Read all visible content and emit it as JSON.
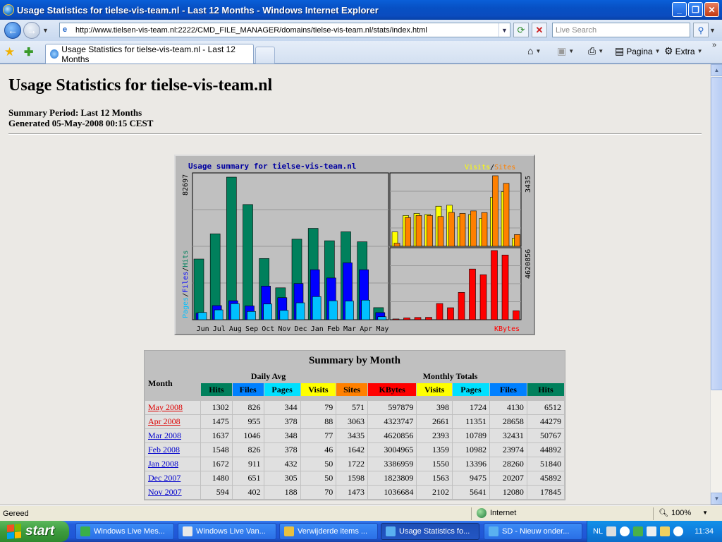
{
  "window": {
    "title": "Usage Statistics for tielse-vis-team.nl - Last 12 Months - Windows Internet Explorer",
    "url": "http://www.tielsen-vis-team.nl:2222/CMD_FILE_MANAGER/domains/tielse-vis-team.nl/stats/index.html",
    "search_placeholder": "Live Search",
    "tab_label": "Usage Statistics for tielse-vis-team.nl - Last 12 Months",
    "cmd_pagina": "Pagina",
    "cmd_extra": "Extra"
  },
  "page": {
    "title": "Usage Statistics for tielse-vis-team.nl",
    "summary_period": "Summary Period: Last 12 Months",
    "generated": "Generated 05-May-2008 00:15 CEST"
  },
  "chart_data": {
    "type": "bar",
    "title": "Usage summary for tielse-vis-team.nl",
    "categories": [
      "Jun",
      "Jul",
      "Aug",
      "Sep",
      "Oct",
      "Nov",
      "Dec",
      "Jan",
      "Feb",
      "Mar",
      "Apr",
      "May"
    ],
    "left_panel": {
      "ylabel_parts": [
        "Pages",
        "/",
        "Files",
        "/",
        "Hits"
      ],
      "ymax_label": "82697",
      "ymax": 82697,
      "series": [
        {
          "name": "Hits",
          "color": "#00805c",
          "values": [
            35200,
            49800,
            82697,
            66800,
            35500,
            18500,
            46700,
            53000,
            45800,
            51000,
            45200,
            7000
          ]
        },
        {
          "name": "Files",
          "color": "#0000ff",
          "values": [
            3800,
            8200,
            11000,
            8000,
            19500,
            12800,
            21000,
            29000,
            24200,
            33000,
            29000,
            4130
          ]
        },
        {
          "name": "Pages",
          "color": "#00c0ff",
          "values": [
            4200,
            5700,
            9300,
            4800,
            9100,
            5400,
            9800,
            13400,
            11000,
            10800,
            11351,
            1724
          ]
        }
      ]
    },
    "right_top_panel": {
      "legend_parts": [
        "Visits",
        "/",
        "Sites"
      ],
      "ymax_label": "3435",
      "ymax": 3435,
      "series": [
        {
          "name": "Visits",
          "color": "#ffff00",
          "values": [
            700,
            1500,
            1600,
            1550,
            1950,
            2000,
            1450,
            1550,
            1359,
            2393,
            2661,
            398
          ]
        },
        {
          "name": "Sites",
          "color": "#ff8000",
          "values": [
            150,
            1400,
            1500,
            1500,
            1450,
            1650,
            1600,
            1722,
            1642,
            3435,
            3063,
            571
          ]
        }
      ]
    },
    "right_bottom_panel": {
      "label": "KBytes",
      "ymax_label": "4620856",
      "ymax": 4620856,
      "series": [
        {
          "name": "KBytes",
          "color": "#ff0000",
          "values": [
            50000,
            120000,
            150000,
            160000,
            1080000,
            800000,
            1823809,
            3386959,
            3004965,
            4620856,
            4323747,
            597879
          ]
        }
      ]
    }
  },
  "summary": {
    "title": "Summary by Month",
    "month_header": "Month",
    "daily_avg_header": "Daily Avg",
    "monthly_totals_header": "Monthly Totals",
    "daily_cols": [
      {
        "label": "Hits",
        "color": "#00805c"
      },
      {
        "label": "Files",
        "color": "#0080ff"
      },
      {
        "label": "Pages",
        "color": "#00e0ff"
      },
      {
        "label": "Visits",
        "color": "#ffff00"
      }
    ],
    "total_cols": [
      {
        "label": "Sites",
        "color": "#ff8000"
      },
      {
        "label": "KBytes",
        "color": "#ff0000"
      },
      {
        "label": "Visits",
        "color": "#ffff00"
      },
      {
        "label": "Pages",
        "color": "#00e0ff"
      },
      {
        "label": "Files",
        "color": "#0080ff"
      },
      {
        "label": "Hits",
        "color": "#00805c"
      }
    ],
    "rows": [
      {
        "month": "May 2008",
        "current": true,
        "d_hits": "1302",
        "d_files": "826",
        "d_pages": "344",
        "d_visits": "79",
        "sites": "571",
        "kbytes": "597879",
        "visits": "398",
        "pages": "1724",
        "files": "4130",
        "hits": "6512"
      },
      {
        "month": "Apr 2008",
        "current": true,
        "d_hits": "1475",
        "d_files": "955",
        "d_pages": "378",
        "d_visits": "88",
        "sites": "3063",
        "kbytes": "4323747",
        "visits": "2661",
        "pages": "11351",
        "files": "28658",
        "hits": "44279"
      },
      {
        "month": "Mar 2008",
        "current": false,
        "d_hits": "1637",
        "d_files": "1046",
        "d_pages": "348",
        "d_visits": "77",
        "sites": "3435",
        "kbytes": "4620856",
        "visits": "2393",
        "pages": "10789",
        "files": "32431",
        "hits": "50767"
      },
      {
        "month": "Feb 2008",
        "current": false,
        "d_hits": "1548",
        "d_files": "826",
        "d_pages": "378",
        "d_visits": "46",
        "sites": "1642",
        "kbytes": "3004965",
        "visits": "1359",
        "pages": "10982",
        "files": "23974",
        "hits": "44892"
      },
      {
        "month": "Jan 2008",
        "current": false,
        "d_hits": "1672",
        "d_files": "911",
        "d_pages": "432",
        "d_visits": "50",
        "sites": "1722",
        "kbytes": "3386959",
        "visits": "1550",
        "pages": "13396",
        "files": "28260",
        "hits": "51840"
      },
      {
        "month": "Dec 2007",
        "current": false,
        "d_hits": "1480",
        "d_files": "651",
        "d_pages": "305",
        "d_visits": "50",
        "sites": "1598",
        "kbytes": "1823809",
        "visits": "1563",
        "pages": "9475",
        "files": "20207",
        "hits": "45892"
      },
      {
        "month": "Nov 2007",
        "current": false,
        "d_hits": "594",
        "d_files": "402",
        "d_pages": "188",
        "d_visits": "70",
        "sites": "1473",
        "kbytes": "1036684",
        "visits": "2102",
        "pages": "5641",
        "files": "12080",
        "hits": "17845"
      }
    ]
  },
  "statusbar": {
    "status": "Gereed",
    "zone": "Internet",
    "zoom": "100%"
  },
  "taskbar": {
    "start_label": "start",
    "tasks": [
      {
        "label": "Windows Live Mes...",
        "icon_color": "#3ab04a",
        "active": false
      },
      {
        "label": "Windows Live Van...",
        "icon_color": "#e8e8e8",
        "active": false
      },
      {
        "label": "Verwijderde items ...",
        "icon_color": "#e8c040",
        "active": false
      },
      {
        "label": "Usage Statistics fo...",
        "icon_color": "#5ab0f0",
        "active": true
      },
      {
        "label": "SD - Nieuw onder...",
        "icon_color": "#5ab0f0",
        "active": false
      }
    ],
    "language": "NL",
    "clock": "11:34"
  }
}
